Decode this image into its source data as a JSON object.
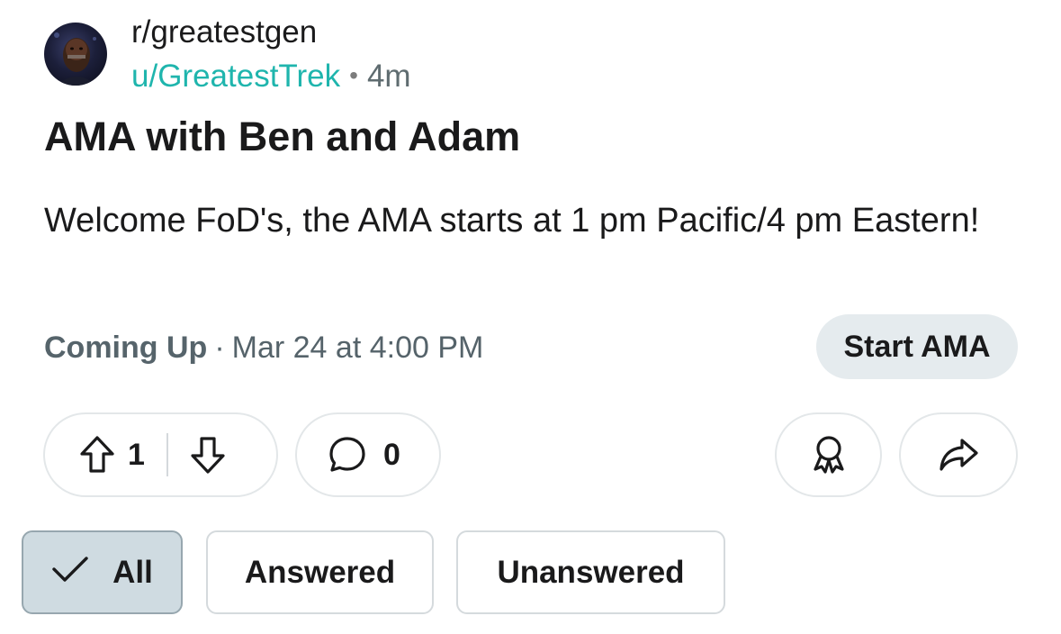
{
  "post": {
    "subreddit": "r/greatestgen",
    "username": "u/GreatestTrek",
    "separator": "•",
    "age": "4m",
    "title": "AMA with Ben and Adam",
    "body": "Welcome FoD's, the AMA starts at 1 pm Pacific/4 pm Eastern!"
  },
  "ama": {
    "status": "Coming Up",
    "separator": "·",
    "datetime": "Mar 24 at 4:00 PM",
    "start_label": "Start AMA"
  },
  "actions": {
    "upvotes": "1",
    "comments": "0",
    "icons": [
      "upvote-icon",
      "downvote-icon",
      "comment-icon",
      "award-icon",
      "share-icon"
    ]
  },
  "filters": {
    "selected": "All",
    "items": [
      "All",
      "Answered",
      "Unanswered"
    ]
  },
  "colors": {
    "username": "#1fb5ad",
    "button_bg": "#e5ebee",
    "selected_chip_bg": "#cfdbe1",
    "muted_text": "#55636a"
  }
}
